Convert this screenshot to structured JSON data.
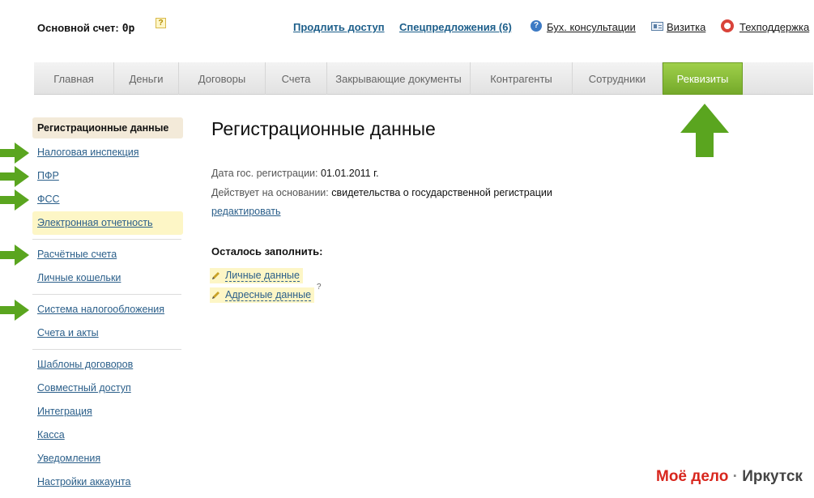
{
  "header": {
    "account_label": "Основной счет:",
    "account_balance": "0р",
    "help_icon_glyph": "?",
    "links": {
      "extend": "Продлить доступ",
      "offers": "Спецпредложения (6)",
      "consult": "Бух. консультации",
      "card": "Визитка",
      "support": "Техподдержка"
    },
    "icons": {
      "consult": "question-circle-icon",
      "card": "business-card-icon",
      "support": "lifebuoy-icon"
    }
  },
  "nav": {
    "tabs": [
      {
        "label": "Главная"
      },
      {
        "label": "Деньги"
      },
      {
        "label": "Договоры"
      },
      {
        "label": "Счета"
      },
      {
        "label": "Закрывающие документы"
      },
      {
        "label": "Контрагенты"
      },
      {
        "label": "Сотрудники"
      },
      {
        "label": "Реквизиты"
      }
    ],
    "active_tab": "Реквизиты",
    "active_color": "#8cc63f"
  },
  "sidebar": {
    "items": [
      {
        "label": "Регистрационные данные"
      },
      {
        "label": "Налоговая инспекция"
      },
      {
        "label": "ПФР"
      },
      {
        "label": "ФСС"
      },
      {
        "label": "Электронная отчетность"
      },
      {
        "label": "Расчётные счета"
      },
      {
        "label": "Личные кошельки"
      },
      {
        "label": "Система налогообложения"
      },
      {
        "label": "Счета и акты"
      },
      {
        "label": "Шаблоны договоров"
      },
      {
        "label": "Совместный доступ"
      },
      {
        "label": "Интеграция"
      },
      {
        "label": "Касса"
      },
      {
        "label": "Уведомления"
      },
      {
        "label": "Настройки аккаунта"
      }
    ],
    "current_item": "Регистрационные данные"
  },
  "main": {
    "title": "Регистрационные данные",
    "reg_date_label": "Дата гос. регистрации:",
    "reg_date_value": "01.01.2011 г.",
    "basis_label": "Действует на основании:",
    "basis_value": "свидетельства о государственной регистрации",
    "edit_link": "редактировать",
    "remaining_title": "Осталось заполнить:",
    "todo": [
      {
        "label": "Личные данные"
      },
      {
        "label": "Адресные данные"
      }
    ],
    "tooltip_glyph": "?"
  },
  "logo": {
    "brand": "Моё дело",
    "separator": "·",
    "city": "Иркутск"
  },
  "colors": {
    "arrow_green": "#5aa51f",
    "link_blue": "#2b5f8a",
    "highlight_yellow": "#fdf6c6",
    "logo_red": "#d8261d"
  }
}
